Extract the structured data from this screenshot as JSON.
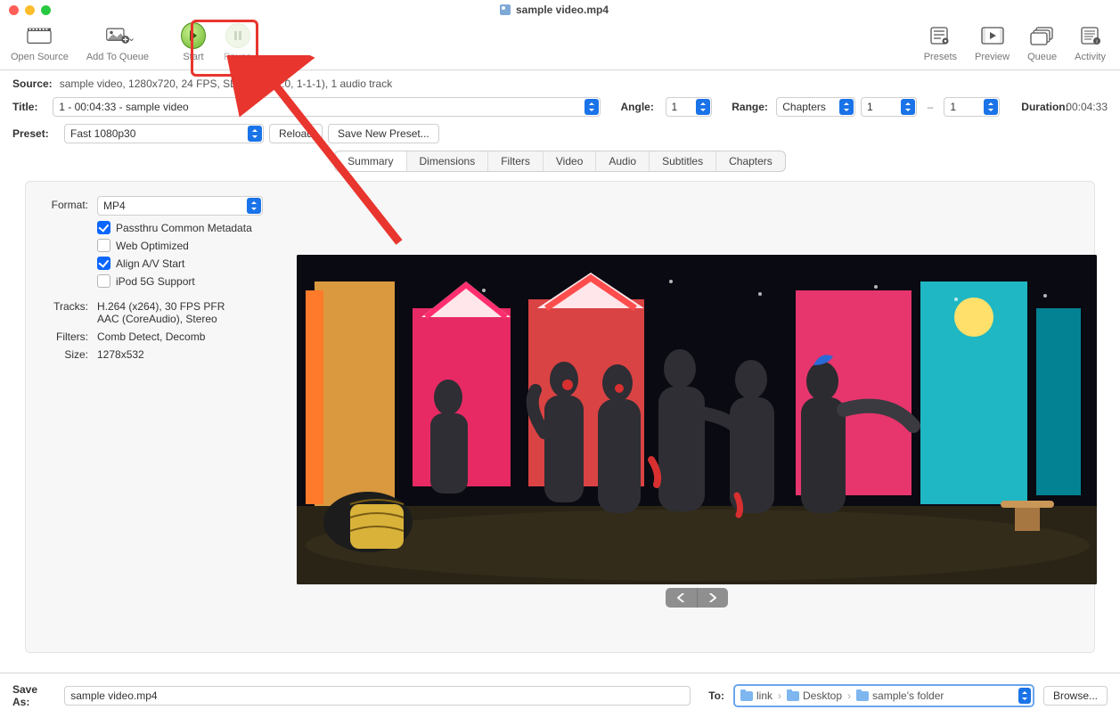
{
  "window": {
    "title": "sample video.mp4"
  },
  "toolbar": {
    "open_source": "Open Source",
    "add_to_queue": "Add To Queue",
    "start": "Start",
    "pause": "Pause",
    "presets": "Presets",
    "preview": "Preview",
    "queue": "Queue",
    "activity": "Activity"
  },
  "source": {
    "label": "Source:",
    "value": "sample video, 1280x720, 24 FPS, SDR (8-bit 2:0, 1-1-1), 1 audio track"
  },
  "title_row": {
    "label": "Title:",
    "value": "1 - 00:04:33 - sample video",
    "angle_label": "Angle:",
    "angle_value": "1",
    "range_label": "Range:",
    "range_value": "Chapters",
    "range_from": "1",
    "range_to": "1",
    "duration_label": "Duration:",
    "duration_value": "00:04:33"
  },
  "preset_row": {
    "label": "Preset:",
    "value": "Fast 1080p30",
    "reload": "Reload",
    "save_new": "Save New Preset..."
  },
  "tabs": [
    "Summary",
    "Dimensions",
    "Filters",
    "Video",
    "Audio",
    "Subtitles",
    "Chapters"
  ],
  "summary": {
    "format_label": "Format:",
    "format_value": "MP4",
    "passthru": "Passthru Common Metadata",
    "web_opt": "Web Optimized",
    "align_av": "Align A/V Start",
    "ipod": "iPod 5G Support",
    "tracks_label": "Tracks:",
    "tracks_value": "H.264 (x264), 30 FPS PFR\nAAC (CoreAudio), Stereo",
    "filters_label": "Filters:",
    "filters_value": "Comb Detect, Decomb",
    "size_label": "Size:",
    "size_value": "1278x532"
  },
  "bottom": {
    "save_as_label": "Save As:",
    "save_as_value": "sample video.mp4",
    "to_label": "To:",
    "crumbs": [
      "link",
      "Desktop",
      "sample's folder"
    ],
    "browse": "Browse..."
  }
}
